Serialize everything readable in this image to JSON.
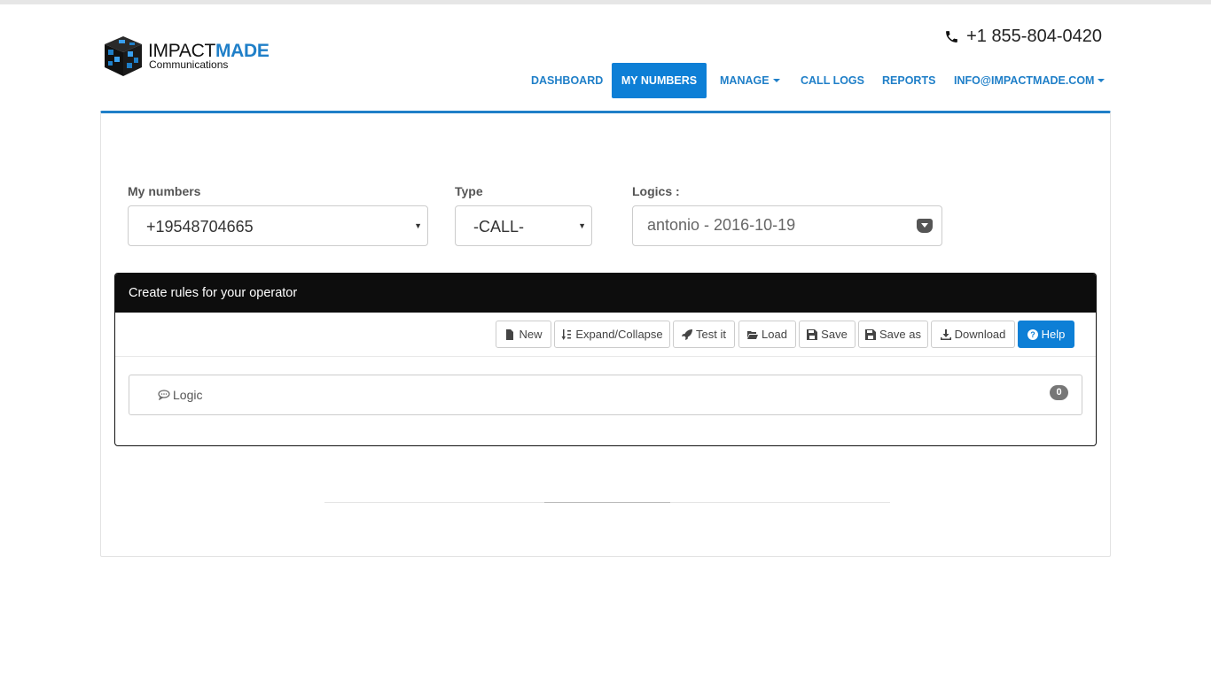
{
  "brand": {
    "logo_main_a": "IMPACT",
    "logo_main_b": "MADE",
    "logo_sub": "Communications",
    "accent_color": "#1f7fc8"
  },
  "header": {
    "phone": "+1 855-804-0420",
    "phone_icon": "phone-icon"
  },
  "nav": {
    "items": [
      {
        "label": "DASHBOARD"
      },
      {
        "label": "MY NUMBERS",
        "active": true
      },
      {
        "label": "MANAGE",
        "dropdown": true
      },
      {
        "label": "CALL LOGS"
      },
      {
        "label": "REPORTS"
      },
      {
        "label": "INFO@IMPACTMADE.COM",
        "dropdown": true
      }
    ]
  },
  "form": {
    "my_numbers": {
      "label": "My numbers",
      "value": "+19548704665"
    },
    "type": {
      "label": "Type",
      "value": "-CALL-"
    },
    "logics": {
      "label": "Logics :",
      "value": "antonio - 2016-10-19"
    }
  },
  "panel": {
    "title": "Create rules for your operator",
    "toolbar": [
      {
        "label": "New",
        "icon": "file-icon"
      },
      {
        "label": "Expand/Collapse",
        "icon": "sort-icon"
      },
      {
        "label": "Test it",
        "icon": "rocket-icon"
      },
      {
        "label": "Load",
        "icon": "folder-open-icon"
      },
      {
        "label": "Save",
        "icon": "floppy-icon"
      },
      {
        "label": "Save as",
        "icon": "floppy-icon"
      },
      {
        "label": "Download",
        "icon": "download-icon"
      },
      {
        "label": "Help",
        "icon": "question-circle-icon"
      }
    ],
    "logic_item": {
      "label": "Logic",
      "count": "0"
    }
  }
}
